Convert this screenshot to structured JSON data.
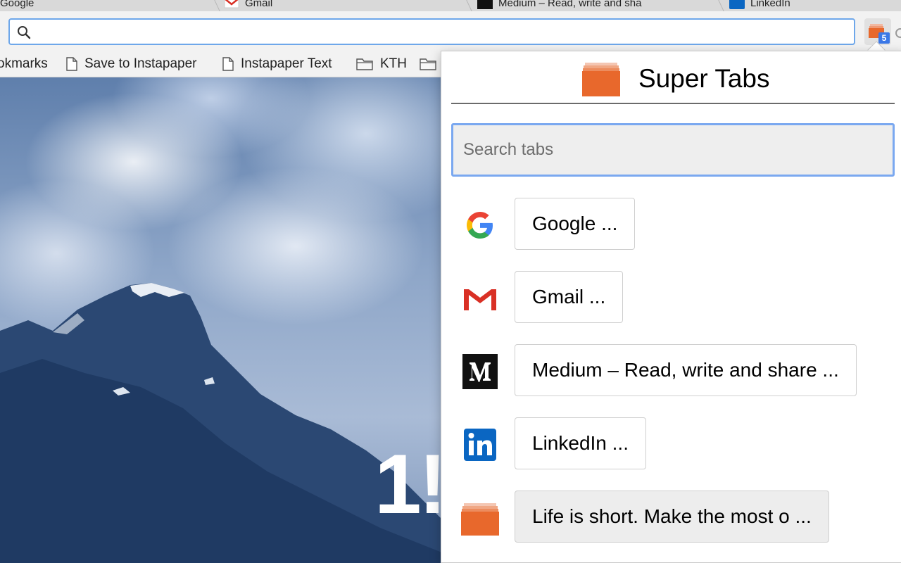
{
  "browser": {
    "tabs": [
      {
        "title": "Google"
      },
      {
        "title": "Gmail"
      },
      {
        "title": "Medium – Read, write and sha"
      },
      {
        "title": "LinkedIn"
      }
    ],
    "omnibox": {
      "value": "",
      "placeholder": ""
    },
    "extension": {
      "badge": "5"
    },
    "bookmarks": [
      {
        "label": "okmarks",
        "icon": "none"
      },
      {
        "label": "Save to Instapaper",
        "icon": "page-icon"
      },
      {
        "label": "Instapaper Text",
        "icon": "page-icon"
      },
      {
        "label": "KTH",
        "icon": "folder-icon"
      },
      {
        "label": "",
        "icon": "folder-icon"
      }
    ]
  },
  "wallpaper": {
    "clock_partial": "1!"
  },
  "popup": {
    "title": "Super Tabs",
    "search_placeholder": "Search tabs",
    "search_value": "",
    "tabs": [
      {
        "label": "Google ...",
        "icon": "google-g-icon"
      },
      {
        "label": "Gmail ...",
        "icon": "gmail-icon"
      },
      {
        "label": "Medium – Read, write and share ...",
        "icon": "medium-icon"
      },
      {
        "label": "LinkedIn ...",
        "icon": "linkedin-icon"
      },
      {
        "label": "Life is short. Make the most o ...",
        "icon": "super-tabs-icon"
      }
    ]
  },
  "colors": {
    "accent_orange": "#e8682c",
    "focus_blue": "#7aa8f0",
    "badge_blue": "#3b78e7",
    "linkedin_blue": "#0a66c2",
    "gmail_red": "#d93025"
  }
}
